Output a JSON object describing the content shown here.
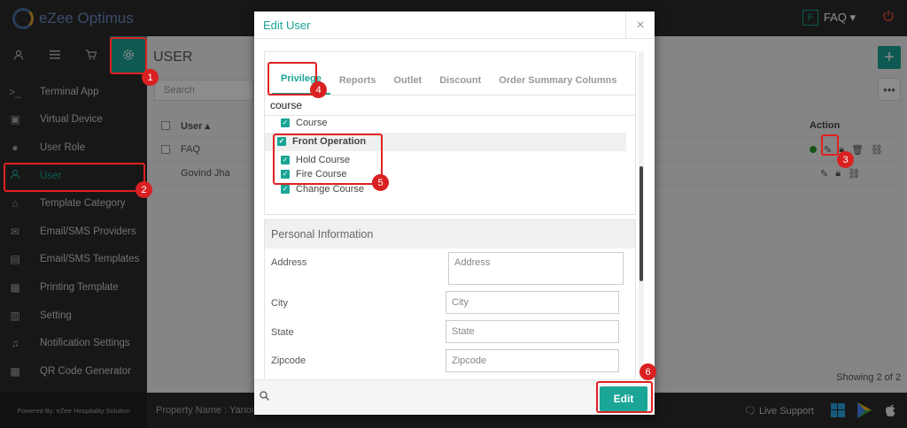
{
  "app": {
    "logo_text": "eZee Optimus",
    "powered_by": "Powered By: eZee Hospitality Solution"
  },
  "header": {
    "faq_box": "F",
    "faq_label": "FAQ ▾"
  },
  "sidebar": {
    "top_icons": [
      "user-icon",
      "menu-icon",
      "cart-icon",
      "gear-icon"
    ],
    "items": [
      {
        "label": "Terminal App",
        "icon": "terminal-icon"
      },
      {
        "label": "Virtual Device",
        "icon": "device-icon"
      },
      {
        "label": "User Role",
        "icon": "user-role-icon"
      },
      {
        "label": "User",
        "icon": "user-icon",
        "active": true
      },
      {
        "label": "Template Category",
        "icon": "inbox-icon"
      },
      {
        "label": "Email/SMS Providers",
        "icon": "envelope-icon"
      },
      {
        "label": "Email/SMS Templates",
        "icon": "calendar-icon"
      },
      {
        "label": "Printing Template",
        "icon": "document-icon"
      },
      {
        "label": "Setting",
        "icon": "settings-icon"
      },
      {
        "label": "Notification Settings",
        "icon": "bell-icon"
      },
      {
        "label": "QR Code Generator",
        "icon": "qr-icon"
      }
    ]
  },
  "main": {
    "title": "USER",
    "search_placeholder": "Search",
    "table": {
      "col_user": "User ▴",
      "col_action": "Action",
      "rows": [
        {
          "user": "FAQ"
        },
        {
          "user": "Govind Jha"
        }
      ]
    },
    "showing": "Showing 2 of 2",
    "property_label": "Property Name : Yanoi",
    "live_support": "Live Support"
  },
  "modal": {
    "title": "Edit User",
    "close": "×",
    "tabs": [
      "Privilege",
      "Reports",
      "Outlet",
      "Discount",
      "Order Summary Columns"
    ],
    "privilege_search": "course",
    "privileges": [
      {
        "label": "Course",
        "group": false
      },
      {
        "label": "Front Operation",
        "group": true
      },
      {
        "label": "Hold Course",
        "group": false
      },
      {
        "label": "Fire Course",
        "group": false
      },
      {
        "label": "Change Course",
        "group": false
      }
    ],
    "personal_title": "Personal Information",
    "fields": [
      {
        "label": "Address",
        "placeholder": "Address"
      },
      {
        "label": "City",
        "placeholder": "City"
      },
      {
        "label": "State",
        "placeholder": "State"
      },
      {
        "label": "Zipcode",
        "placeholder": "Zipcode"
      }
    ],
    "edit_button": "Edit"
  },
  "annotations": [
    "1",
    "2",
    "3",
    "4",
    "5",
    "6"
  ],
  "colors": {
    "accent": "#1aa596",
    "sidebar_bg": "#2b2b2b",
    "annotation_red": "#e02020"
  }
}
